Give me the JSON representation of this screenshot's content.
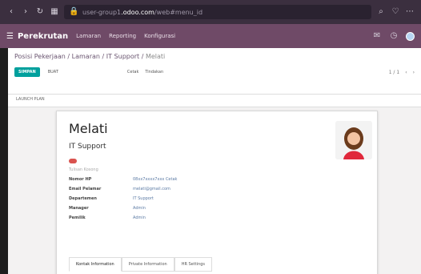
{
  "browser": {
    "url_prefix": "user-group1",
    "url_domain": ".odoo.com",
    "url_path": "/web#menu_id"
  },
  "nav": {
    "app_name": "Perekrutan",
    "menus": [
      "Lamaran",
      "Reporting",
      "Konfigurasi"
    ]
  },
  "breadcrumb": {
    "path": "Posisi Pekerjaan / Lamaran / IT Support / ",
    "current": "Melati"
  },
  "controls": {
    "primary_label": "SIMPAN",
    "secondary_label": "BUAT",
    "tool_1": "Cetak",
    "tool_2": "Tindakan",
    "pager": "1 / 1"
  },
  "status": {
    "label": "LAUNCH PLAN"
  },
  "record": {
    "name": "Melati",
    "job": "IT Support",
    "desc": "Tulisan Kosong",
    "fields": [
      {
        "label": "Nomor HP",
        "value": "08xx7xxxx7xxx Cetak"
      },
      {
        "label": "Email Pelamar",
        "value": "melati@gmail.com"
      },
      {
        "label": "Departemen",
        "value": "IT Support"
      },
      {
        "label": "Manager",
        "value": "Admin"
      },
      {
        "label": "Pemilik",
        "value": "Admin"
      }
    ]
  },
  "tabs": [
    "Kontak Information",
    "Private Information",
    "HR Settings"
  ],
  "colors": {
    "accent": "#00a09d",
    "nav": "#6f4a67",
    "tag": "#d9534f"
  }
}
